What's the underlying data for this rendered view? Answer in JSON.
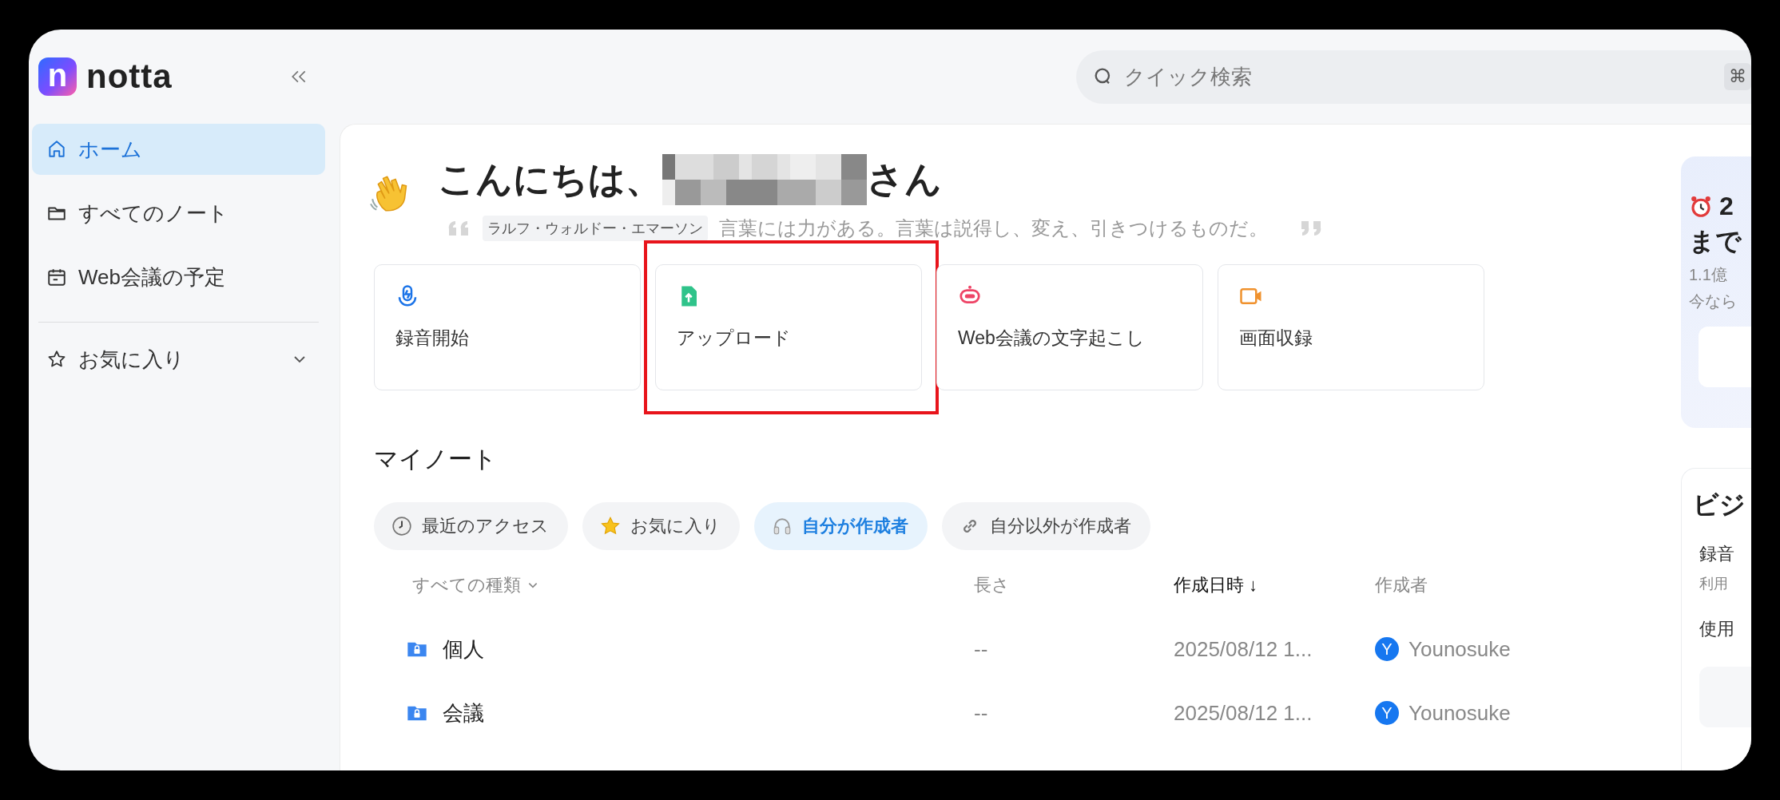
{
  "logo": {
    "mark": "n",
    "name": "notta"
  },
  "sidebar": {
    "items": [
      {
        "kind": "home",
        "label": "ホーム",
        "selected": true
      },
      {
        "kind": "notes",
        "label": "すべてのノート",
        "selected": false
      },
      {
        "kind": "calendar",
        "label": "Web会議の予定",
        "selected": false
      }
    ],
    "favorites": {
      "label": "お気に入り",
      "expanded": false
    }
  },
  "search": {
    "placeholder": "クイック検索",
    "shortcut": "⌘"
  },
  "greeting": {
    "prefix": "こんにちは、",
    "suffix": "さん"
  },
  "quote": {
    "author": "ラルフ・ウォルドー・エマーソン",
    "text": "言葉には力がある。言葉は説得し、変え、引きつけるものだ。"
  },
  "actions": [
    {
      "kind": "record",
      "label": "録音開始",
      "highlighted": false
    },
    {
      "kind": "upload",
      "label": "アップロード",
      "highlighted": true
    },
    {
      "kind": "meeting",
      "label": "Web会議の文字起こし",
      "highlighted": false
    },
    {
      "kind": "screen",
      "label": "画面収録",
      "highlighted": false
    }
  ],
  "my_notes": {
    "title": "マイノート",
    "filters": [
      {
        "kind": "recent",
        "label": "最近のアクセス",
        "selected": false
      },
      {
        "kind": "favorite",
        "label": "お気に入り",
        "selected": false
      },
      {
        "kind": "mine",
        "label": "自分が作成者",
        "selected": true
      },
      {
        "kind": "others",
        "label": "自分以外が作成者",
        "selected": false
      }
    ],
    "columns": [
      {
        "kind": "dropdown",
        "label": "すべての種類",
        "sorted": false
      },
      {
        "kind": "plain",
        "label": "長さ",
        "sorted": false
      },
      {
        "kind": "plain",
        "label": "作成日時",
        "sorted": true,
        "sort_arrow": "↓"
      },
      {
        "kind": "plain",
        "label": "作成者",
        "sorted": false
      }
    ],
    "rows": [
      {
        "name": "個人",
        "length": "--",
        "created": "2025/08/12 1...",
        "avatar": "Y",
        "creator": "Younosuke"
      },
      {
        "name": "会議",
        "length": "--",
        "created": "2025/08/12 1...",
        "avatar": "Y",
        "creator": "Younosuke"
      }
    ]
  },
  "promo": {
    "title": "2",
    "title_line2": "まで",
    "lines": [
      "1.1億",
      "今なら"
    ]
  },
  "business": {
    "title": "ビジ",
    "heading": "録音",
    "note": "利用",
    "usage": "使用"
  }
}
